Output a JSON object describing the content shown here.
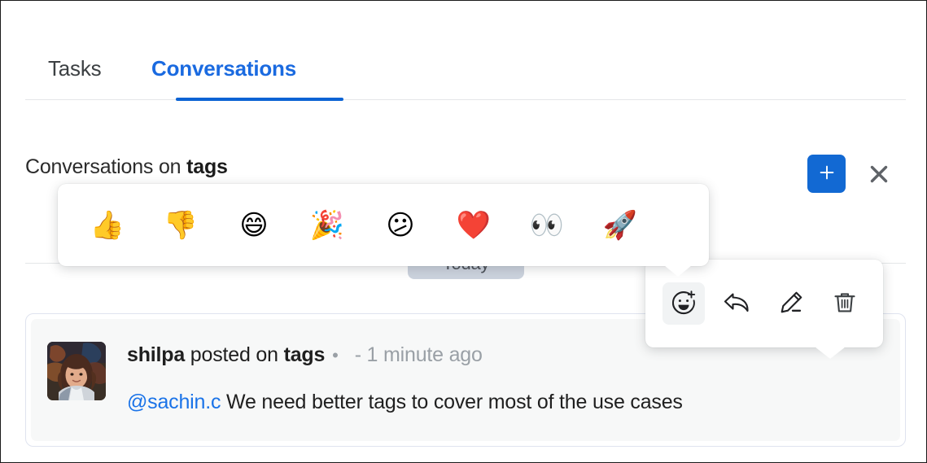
{
  "colors": {
    "accent": "#0b63d4",
    "accent_text": "#1a6ae0",
    "mention": "#1a73e8",
    "muted": "#9aa0a6",
    "add_button_bg": "#1269d3",
    "day_pill_bg": "#ccd3de",
    "card_border": "#dfe3ef",
    "card_inner_bg": "#f7f8f8",
    "divider": "#e4e6e8"
  },
  "tabs": [
    {
      "label": "Tasks",
      "active": false
    },
    {
      "label": "Conversations",
      "active": true
    }
  ],
  "header": {
    "title_prefix": "Conversations on ",
    "title_subject": "tags",
    "add_button_label": "+",
    "add_button_icon": "plus-icon",
    "close_button_label": "✕",
    "close_button_icon": "close-icon"
  },
  "day_divider": {
    "label": "Today"
  },
  "emoji_picker": {
    "items": [
      {
        "name": "thumbs-up",
        "glyph": "👍"
      },
      {
        "name": "thumbs-down",
        "glyph": "👎"
      },
      {
        "name": "grinning-face",
        "glyph": "😄"
      },
      {
        "name": "party-popper",
        "glyph": "🎉"
      },
      {
        "name": "confused-face",
        "glyph": "😕"
      },
      {
        "name": "red-heart",
        "glyph": "❤️"
      },
      {
        "name": "eyes",
        "glyph": "👀"
      },
      {
        "name": "rocket",
        "glyph": "🚀"
      }
    ]
  },
  "action_toolbar": {
    "items": [
      {
        "name": "add-reaction-icon",
        "label": "Add reaction",
        "active": true
      },
      {
        "name": "reply-icon",
        "label": "Reply",
        "active": false
      },
      {
        "name": "edit-icon",
        "label": "Edit",
        "active": false
      },
      {
        "name": "delete-icon",
        "label": "Delete",
        "active": false
      }
    ]
  },
  "post": {
    "author": "shilpa",
    "action": " posted on ",
    "target": "tags",
    "separator": "•",
    "timestamp": "- 1 minute ago",
    "mention": "@sachin.c",
    "body": " We need better tags to cover most of the use cases",
    "avatar_alt": "shilpa"
  }
}
